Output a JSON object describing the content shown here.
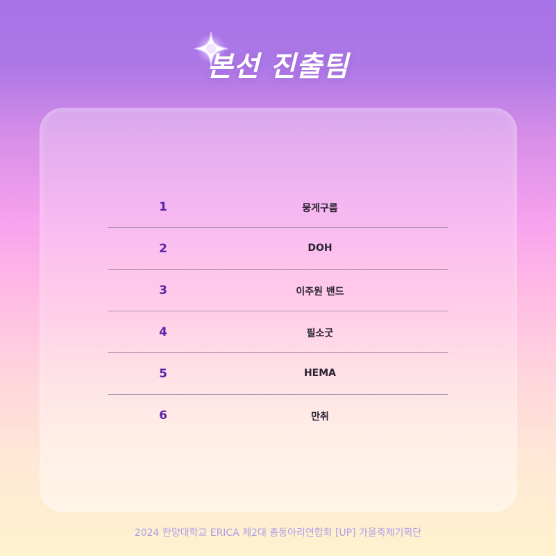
{
  "title": "본선 진출팀",
  "teams": [
    {
      "rank": "1",
      "name": "뭉게구름"
    },
    {
      "rank": "2",
      "name": "DOH"
    },
    {
      "rank": "3",
      "name": "이주원 밴드"
    },
    {
      "rank": "4",
      "name": "필소굿"
    },
    {
      "rank": "5",
      "name": "HEMA"
    },
    {
      "rank": "6",
      "name": "만취"
    }
  ],
  "footer": "2024 한양대학교 ERICA 제2대 총동아리연합회 [UP] 가을축제기획단",
  "colors": {
    "rank": "#5a21a8",
    "footer": "#a99ee9",
    "bg_top": "#a673e6",
    "bg_bottom": "#fff2cf"
  },
  "icons": {
    "title_decoration": "sparkle-icon"
  }
}
